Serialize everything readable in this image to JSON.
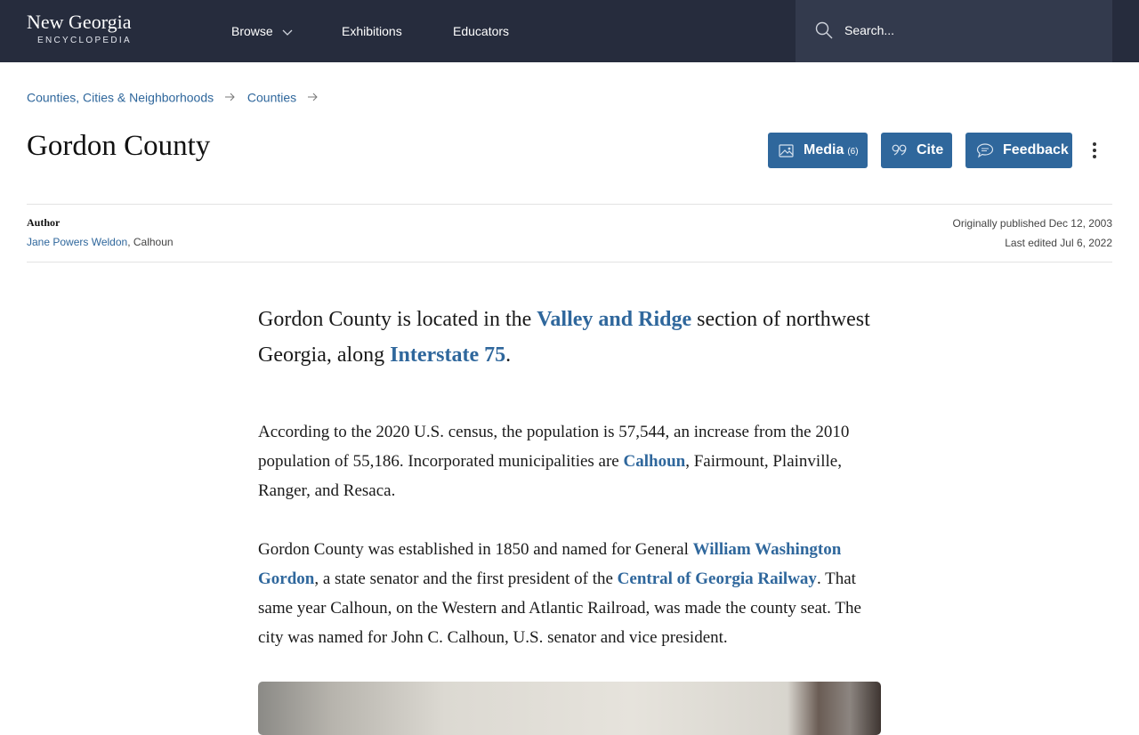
{
  "nav": {
    "logo_main": "New Georgia",
    "logo_sub": "ENCYCLOPEDIA",
    "items": [
      "Browse",
      "Exhibitions",
      "Educators"
    ],
    "search_placeholder": "Search..."
  },
  "breadcrumb": [
    "Counties, Cities & Neighborhoods",
    "Counties"
  ],
  "page": {
    "title": "Gordon County",
    "buttons": {
      "media": "Media",
      "media_count": "(6)",
      "cite": "Cite",
      "feedback": "Feedback"
    }
  },
  "meta": {
    "author_label": "Author",
    "author_name": "Jane Powers Weldon",
    "author_place": ", Calhoun",
    "published": "Originally published Dec 12, 2003",
    "edited": "Last edited Jul 6, 2022"
  },
  "article": {
    "lead": {
      "t1": "Gordon County is located in the ",
      "l1": "Valley and Ridge",
      "t2": " section of northwest Georgia, along ",
      "l2": "Interstate 75",
      "t3": "."
    },
    "p1": {
      "t1": "According to the 2020 U.S. census, the population is 57,544, an increase from the 2010 population of 55,186. Incorporated municipalities are ",
      "l1": "Calhoun",
      "t2": ", Fairmount, Plainville, Ranger, and Resaca."
    },
    "p2": {
      "t1": "Gordon County was established in 1850 and named for General ",
      "l1": "William Washington Gordon",
      "t2": ", a state senator and the first president of the ",
      "l2": "Central of Georgia Railway",
      "t3": ". That same year Calhoun, on the Western and Atlantic Railroad, was made the county seat. The city was named for John C. Calhoun, U.S. senator and vice president."
    }
  },
  "colors": {
    "nav_bg": "#262c3d",
    "accent": "#2f679c"
  }
}
